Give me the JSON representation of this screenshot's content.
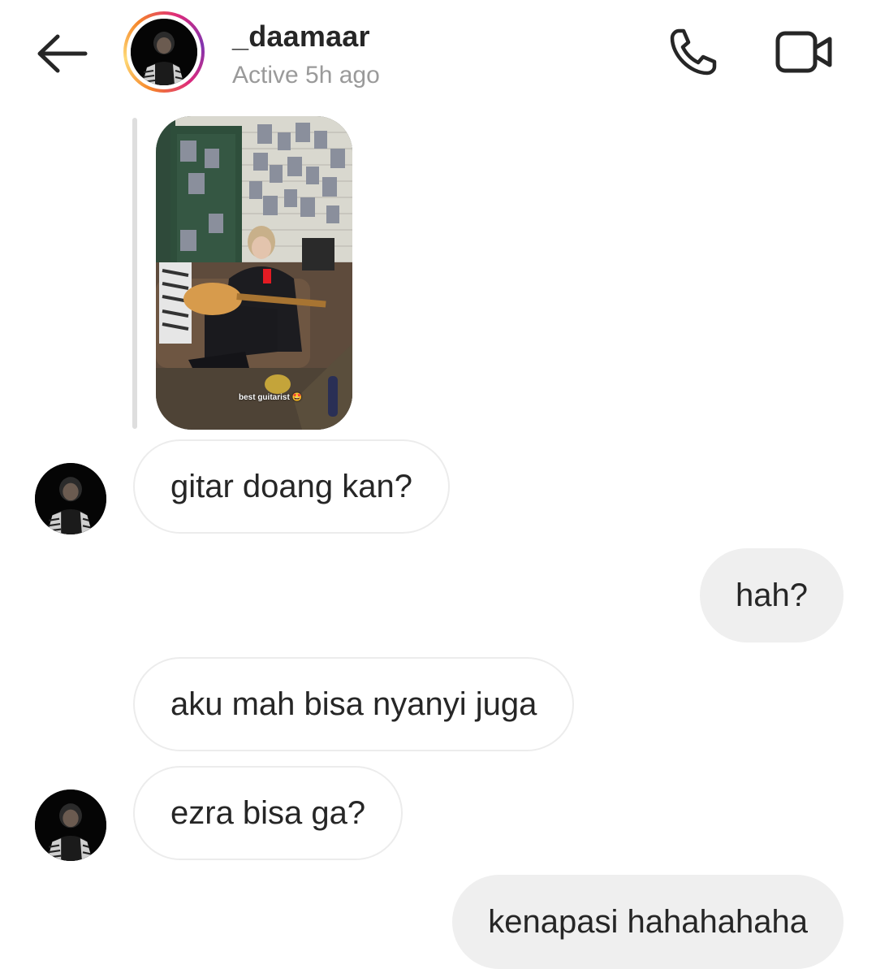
{
  "header": {
    "username": "_daamaar",
    "status": "Active 5h ago",
    "back_icon": "arrow-left-icon",
    "call_icon": "phone-icon",
    "video_icon": "video-camera-icon",
    "story_ring_colors": [
      "#f58529",
      "#feda77",
      "#dd2a7b",
      "#8134af"
    ]
  },
  "story_reply": {
    "caption": "best guitarist 🤩"
  },
  "messages": [
    {
      "direction": "incoming",
      "text": "gitar doang kan?",
      "show_avatar": true
    },
    {
      "direction": "outgoing",
      "text": "hah?"
    },
    {
      "direction": "incoming",
      "text": "aku mah bisa nyanyi juga",
      "show_avatar": false
    },
    {
      "direction": "incoming",
      "text": "ezra bisa ga?",
      "show_avatar": true
    },
    {
      "direction": "outgoing",
      "text": "kenapasi hahahahaha"
    }
  ],
  "colors": {
    "incoming_bubble_bg": "#ffffff",
    "incoming_bubble_border": "#ececec",
    "outgoing_bubble_bg": "#efefef",
    "text": "#262626",
    "muted": "#9a9a9a"
  }
}
